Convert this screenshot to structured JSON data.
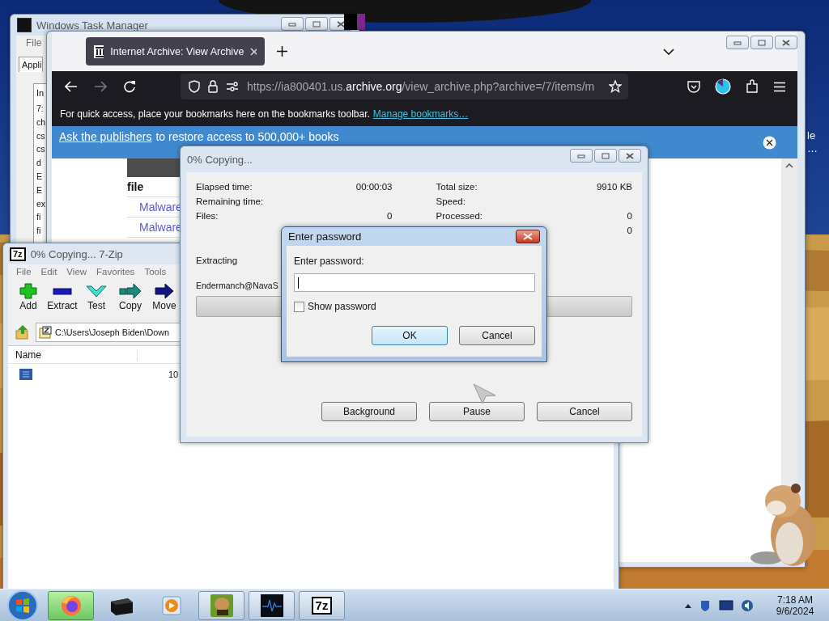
{
  "desktop": {
    "icon_labels": [
      "le",
      "…"
    ]
  },
  "task_manager": {
    "title": "Windows Task Manager",
    "menu": [
      "File"
    ],
    "tabs": [
      {
        "label": "Appli",
        "selected": true
      }
    ],
    "column": "In",
    "rows": [
      "7:",
      "ch",
      "cs",
      "cs",
      "d",
      "E",
      "E",
      "ex",
      "fi",
      "fi"
    ]
  },
  "browser": {
    "tab": {
      "title": "Internet Archive: View Archive",
      "selected": true
    },
    "url": {
      "prefix": "https://ia800401.us.",
      "domain": "archive.org",
      "path": "/view_archive.php?archive=/7/items/m"
    },
    "bookmarks_hint": "For quick access, place your bookmarks here on the bookmarks toolbar.",
    "bookmarks_link": "Manage bookmarks…",
    "banner": {
      "link": "Ask the publishers",
      "text": "to restore access to 500,000+ books"
    },
    "page": {
      "column": "file",
      "links": [
        "Malware",
        "Malware"
      ]
    }
  },
  "sevenzip": {
    "icon_label": "7z",
    "title": "0% Copying... 7-Zip",
    "menu": [
      "File",
      "Edit",
      "View",
      "Favorites",
      "Tools"
    ],
    "toolbar": [
      {
        "kind": "add",
        "label": "Add"
      },
      {
        "kind": "extract",
        "label": "Extract"
      },
      {
        "kind": "test",
        "label": "Test"
      },
      {
        "kind": "copy",
        "label": "Copy"
      },
      {
        "kind": "move",
        "label": "Move"
      }
    ],
    "path": "C:\\Users\\Joseph Biden\\Down",
    "column": "Name",
    "rows": [
      {
        "size": "10"
      }
    ]
  },
  "progress": {
    "title": "0% Copying...",
    "left": [
      {
        "label": "Elapsed time:",
        "value": "00:00:03"
      },
      {
        "label": "Remaining time:"
      },
      {
        "label": "Files:",
        "value": "0"
      }
    ],
    "right": [
      {
        "label": "Total size:",
        "value": "9910 KB"
      },
      {
        "label": "Speed:"
      },
      {
        "label": "Processed:",
        "value": "0"
      },
      {
        "value": "0"
      }
    ],
    "operation": "Extracting",
    "file": "Endermanch@NavaS",
    "level": 0,
    "buttons": [
      "Background",
      "Pause",
      "Cancel"
    ]
  },
  "password": {
    "title": "Enter password",
    "label": "Enter password:",
    "show_password": {
      "label": "Show password",
      "checked": false
    },
    "buttons": [
      {
        "label": "OK",
        "default": true
      },
      {
        "label": "Cancel",
        "default": false
      }
    ]
  },
  "taskbar": {
    "items": [
      {
        "kind": "browser",
        "running": true,
        "active": true
      },
      {
        "kind": "box",
        "running": false,
        "active": false
      },
      {
        "kind": "media",
        "running": false,
        "active": false
      },
      {
        "kind": "game",
        "running": true,
        "active": false
      },
      {
        "kind": "monitor",
        "running": true,
        "active": false
      },
      {
        "kind": "archiver",
        "label": "7z",
        "running": true,
        "active": false
      }
    ],
    "time": "7:18 AM",
    "date": "9/6/2024"
  }
}
